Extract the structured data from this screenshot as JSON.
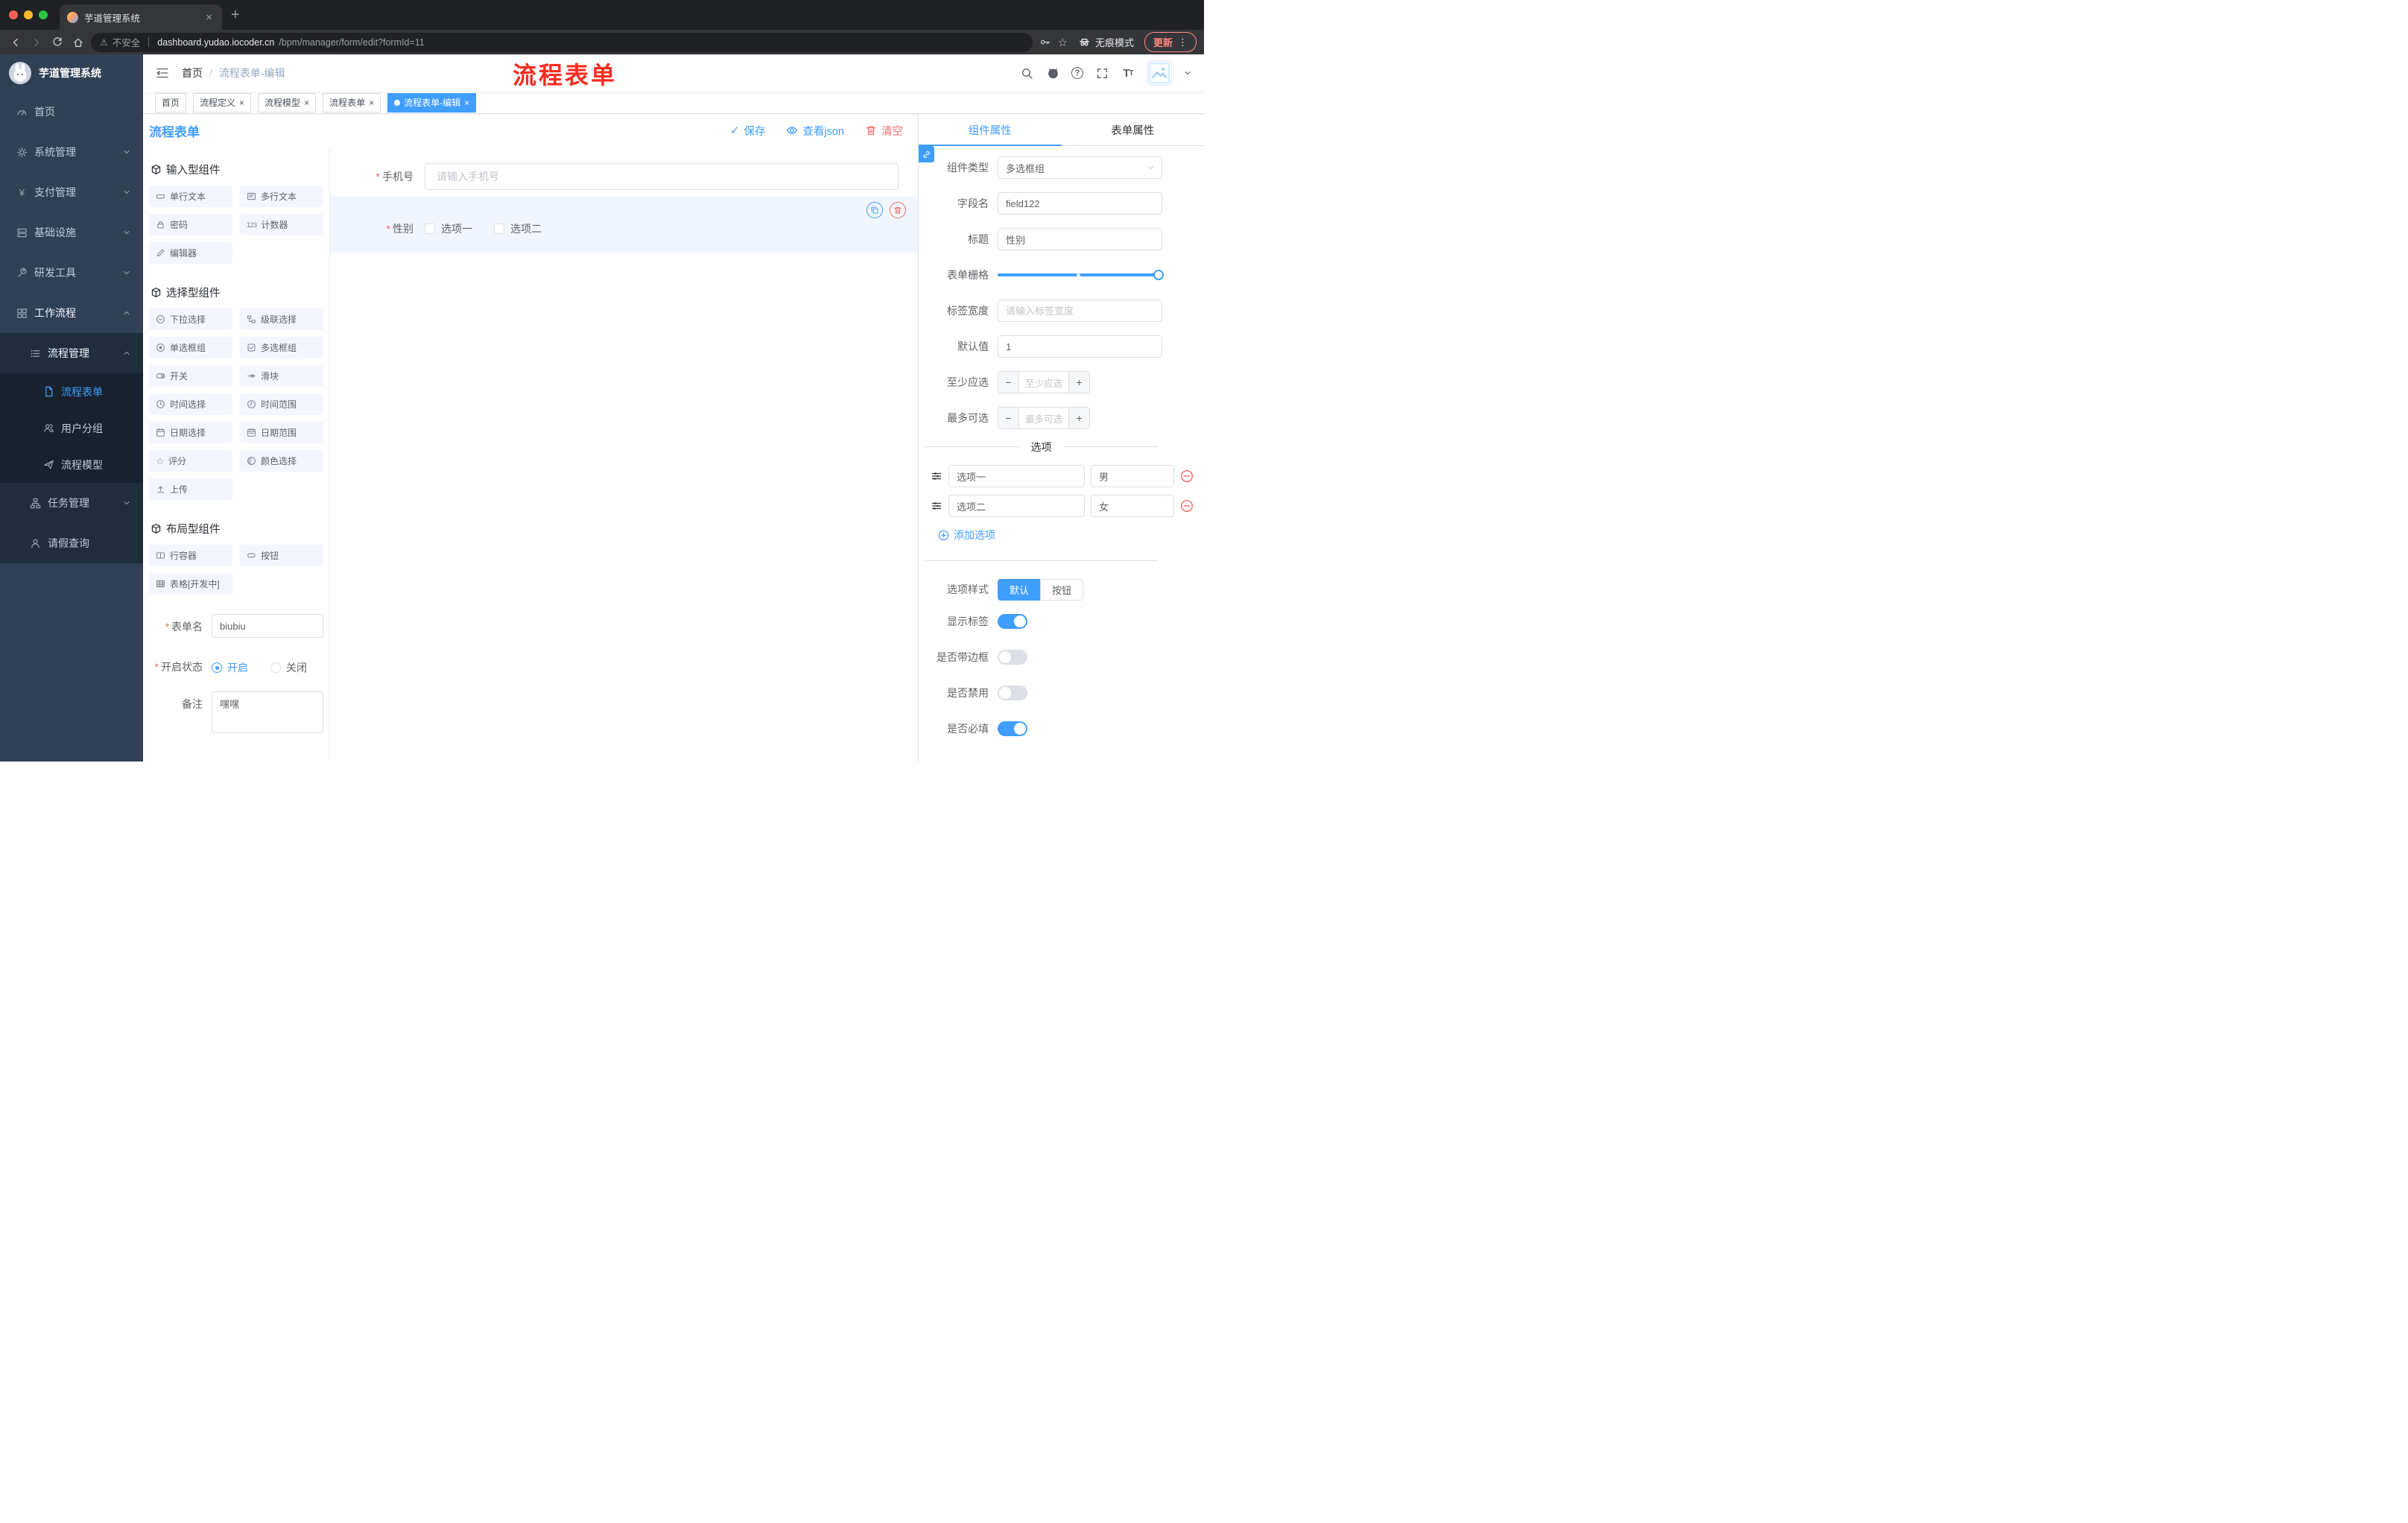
{
  "colors": {
    "primary": "#409eff",
    "danger": "#f56c6c",
    "annotation_red": "#fb2b20",
    "sidebar_bg": "#304156",
    "active_tag_bg": "#409eff"
  },
  "browser": {
    "tab_title": "芋道管理系统",
    "security_label": "不安全",
    "url_host": "dashboard.yudao.iocoder.cn",
    "url_path": "/bpm/manager/form/edit?formId=11",
    "incognito_label": "无痕模式",
    "update_label": "更新"
  },
  "annotation_text": "流程表单",
  "navbar": {
    "breadcrumb_home": "首页",
    "breadcrumb_current": "流程表单-编辑"
  },
  "tags": [
    {
      "label": "首页",
      "closable": false,
      "active": false
    },
    {
      "label": "流程定义",
      "closable": true,
      "active": false
    },
    {
      "label": "流程模型",
      "closable": true,
      "active": false
    },
    {
      "label": "流程表单",
      "closable": true,
      "active": false
    },
    {
      "label": "流程表单-编辑",
      "closable": true,
      "active": true
    }
  ],
  "sidebar": {
    "logo_title": "芋道管理系统",
    "items": [
      {
        "label": "首页"
      },
      {
        "label": "系统管理"
      },
      {
        "label": "支付管理"
      },
      {
        "label": "基础设施"
      },
      {
        "label": "研发工具"
      },
      {
        "label": "工作流程"
      },
      {
        "label": "流程管理"
      },
      {
        "label": "流程表单"
      },
      {
        "label": "用户分组"
      },
      {
        "label": "流程模型"
      },
      {
        "label": "任务管理"
      },
      {
        "label": "请假查询"
      }
    ]
  },
  "designer": {
    "title": "流程表单",
    "save_label": "保存",
    "view_json_label": "查看json",
    "clear_label": "清空",
    "groups": [
      {
        "title": "输入型组件",
        "items": [
          "单行文本",
          "多行文本",
          "密码",
          "计数器",
          "编辑器"
        ]
      },
      {
        "title": "选择型组件",
        "items": [
          "下拉选择",
          "级联选择",
          "单选框组",
          "多选框组",
          "开关",
          "滑块",
          "时间选择",
          "时间范围",
          "日期选择",
          "日期范围",
          "评分",
          "颜色选择",
          "上传"
        ]
      },
      {
        "title": "布局型组件",
        "items": [
          "行容器",
          "按钮",
          "表格[开发中]"
        ]
      }
    ],
    "meta": {
      "form_name_label": "表单名",
      "form_name_value": "biubiu",
      "status_label": "开启状态",
      "status_on": "开启",
      "status_off": "关闭",
      "remark_label": "备注",
      "remark_value": "嘿嘿"
    },
    "canvas": {
      "phone_label": "手机号",
      "phone_placeholder": "请输入手机号",
      "gender_label": "性别",
      "gender_option1": "选项一",
      "gender_option2": "选项二"
    }
  },
  "props": {
    "tab_component": "组件属性",
    "tab_form": "表单属性",
    "component_type_label": "组件类型",
    "component_type_value": "多选框组",
    "field_name_label": "字段名",
    "field_name_value": "field122",
    "title_label": "标题",
    "title_value": "性别",
    "grid_label": "表单栅格",
    "label_width_label": "标签宽度",
    "label_width_placeholder": "请输入标签宽度",
    "default_label": "默认值",
    "default_value": "1",
    "min_label": "至少应选",
    "min_placeholder": "至少应选",
    "max_label": "最多可选",
    "max_placeholder": "最多可选",
    "options_divider": "选项",
    "options": [
      {
        "label": "选项一",
        "value": "男"
      },
      {
        "label": "选项二",
        "value": "女"
      }
    ],
    "add_option": "添加选项",
    "option_style_label": "选项样式",
    "style_default": "默认",
    "style_button": "按钮",
    "toggle_show_label": "显示标签",
    "toggle_border": "是否带边框",
    "toggle_disabled": "是否禁用",
    "toggle_required": "是否必填"
  },
  "icons": [
    "search-icon",
    "github-icon",
    "help-icon",
    "fullscreen-icon",
    "font-size-icon",
    "hamburger-icon",
    "save-check-icon",
    "view-json-eye-icon",
    "clear-trash-icon",
    "copy-icon",
    "delete-icon",
    "link-icon",
    "drag-handle-icon",
    "add-circle-icon",
    "remove-circle-icon",
    "incognito-icon",
    "warning-icon",
    "key-icon",
    "star-icon"
  ]
}
